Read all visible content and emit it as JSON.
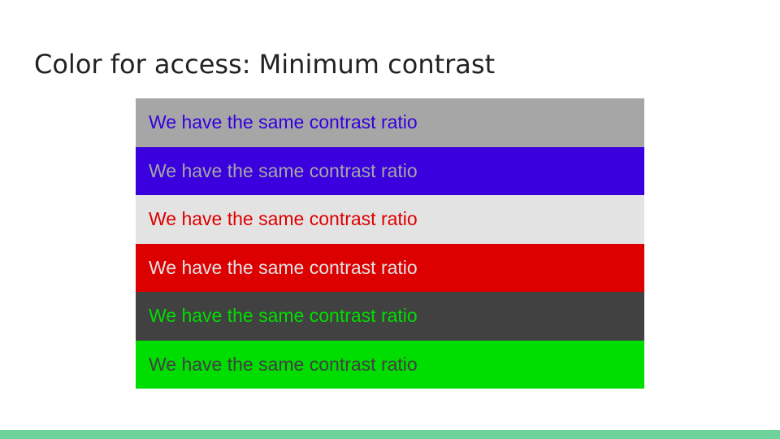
{
  "slide": {
    "title": "Color for access: Minimum contrast"
  },
  "swatches": [
    {
      "text": "We have the same contrast ratio",
      "background": "#a6a6a6",
      "foreground": "#3300dd"
    },
    {
      "text": "We have the same contrast ratio",
      "background": "#3a00dd",
      "foreground": "#a6a6a6"
    },
    {
      "text": "We have the same contrast ratio",
      "background": "#e3e3e3",
      "foreground": "#dd0000"
    },
    {
      "text": "We have the same contrast ratio",
      "background": "#dd0000",
      "foreground": "#e3e3e3"
    },
    {
      "text": "We have the same contrast ratio",
      "background": "#414141",
      "foreground": "#00dd00"
    },
    {
      "text": "We have the same contrast ratio",
      "background": "#00dd00",
      "foreground": "#414141"
    }
  ],
  "colors": {
    "title_text": "#222222",
    "footer_bar": "#6dd39a"
  }
}
